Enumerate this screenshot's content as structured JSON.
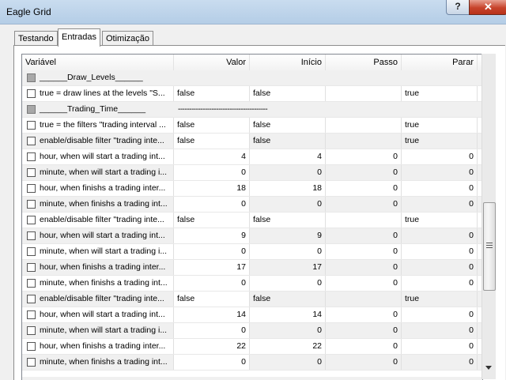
{
  "window": {
    "title": "Eagle Grid",
    "help_label": "?",
    "close_label": "✕"
  },
  "tabs": [
    {
      "label": "Testando",
      "active": false
    },
    {
      "label": "Entradas",
      "active": true
    },
    {
      "label": "Otimização",
      "active": false
    }
  ],
  "grid": {
    "columns": [
      "Variável",
      "Valor",
      "Início",
      "Passo",
      "Parar"
    ],
    "separator_text": "----------------------------------------",
    "rows": [
      {
        "kind": "group",
        "name": "______Draw_Levels______"
      },
      {
        "kind": "row",
        "name": "true = draw lines at the levels \"S...",
        "valor": "false",
        "inicio": "false",
        "passo": "",
        "parar": "true",
        "numeric": false
      },
      {
        "kind": "group",
        "name": "______Trading_Time______",
        "separator": true
      },
      {
        "kind": "row",
        "name": "true = the filters \"trading interval ...",
        "valor": "false",
        "inicio": "false",
        "passo": "",
        "parar": "true",
        "numeric": false
      },
      {
        "kind": "row",
        "name": "enable/disable filter \"trading inte...",
        "valor": "false",
        "inicio": "false",
        "passo": "",
        "parar": "true",
        "numeric": false
      },
      {
        "kind": "row",
        "name": "hour, when will start a trading int...",
        "valor": "4",
        "inicio": "4",
        "passo": "0",
        "parar": "0",
        "numeric": true
      },
      {
        "kind": "row",
        "name": "minute, when will start a trading i...",
        "valor": "0",
        "inicio": "0",
        "passo": "0",
        "parar": "0",
        "numeric": true
      },
      {
        "kind": "row",
        "name": "hour, when finishs a trading inter...",
        "valor": "18",
        "inicio": "18",
        "passo": "0",
        "parar": "0",
        "numeric": true
      },
      {
        "kind": "row",
        "name": "minute, when finishs a trading int...",
        "valor": "0",
        "inicio": "0",
        "passo": "0",
        "parar": "0",
        "numeric": true
      },
      {
        "kind": "row",
        "name": "enable/disable filter \"trading inte...",
        "valor": "false",
        "inicio": "false",
        "passo": "",
        "parar": "true",
        "numeric": false
      },
      {
        "kind": "row",
        "name": "hour, when will start a trading int...",
        "valor": "9",
        "inicio": "9",
        "passo": "0",
        "parar": "0",
        "numeric": true
      },
      {
        "kind": "row",
        "name": "minute, when will start a trading i...",
        "valor": "0",
        "inicio": "0",
        "passo": "0",
        "parar": "0",
        "numeric": true
      },
      {
        "kind": "row",
        "name": "hour, when finishs a trading inter...",
        "valor": "17",
        "inicio": "17",
        "passo": "0",
        "parar": "0",
        "numeric": true
      },
      {
        "kind": "row",
        "name": "minute, when finishs a trading int...",
        "valor": "0",
        "inicio": "0",
        "passo": "0",
        "parar": "0",
        "numeric": true
      },
      {
        "kind": "row",
        "name": "enable/disable filter \"trading inte...",
        "valor": "false",
        "inicio": "false",
        "passo": "",
        "parar": "true",
        "numeric": false
      },
      {
        "kind": "row",
        "name": "hour, when will start a trading int...",
        "valor": "14",
        "inicio": "14",
        "passo": "0",
        "parar": "0",
        "numeric": true
      },
      {
        "kind": "row",
        "name": "minute, when will start a trading i...",
        "valor": "0",
        "inicio": "0",
        "passo": "0",
        "parar": "0",
        "numeric": true
      },
      {
        "kind": "row",
        "name": "hour, when finishs a trading inter...",
        "valor": "22",
        "inicio": "22",
        "passo": "0",
        "parar": "0",
        "numeric": true
      },
      {
        "kind": "row",
        "name": "minute, when finishs a trading int...",
        "valor": "0",
        "inicio": "0",
        "passo": "0",
        "parar": "0",
        "numeric": true
      }
    ]
  },
  "colors": {
    "titlebar": "#b4cde6",
    "close": "#c7432b",
    "alt_row": "#f0f0f0",
    "group_checkbox": "#a8a8a8"
  }
}
